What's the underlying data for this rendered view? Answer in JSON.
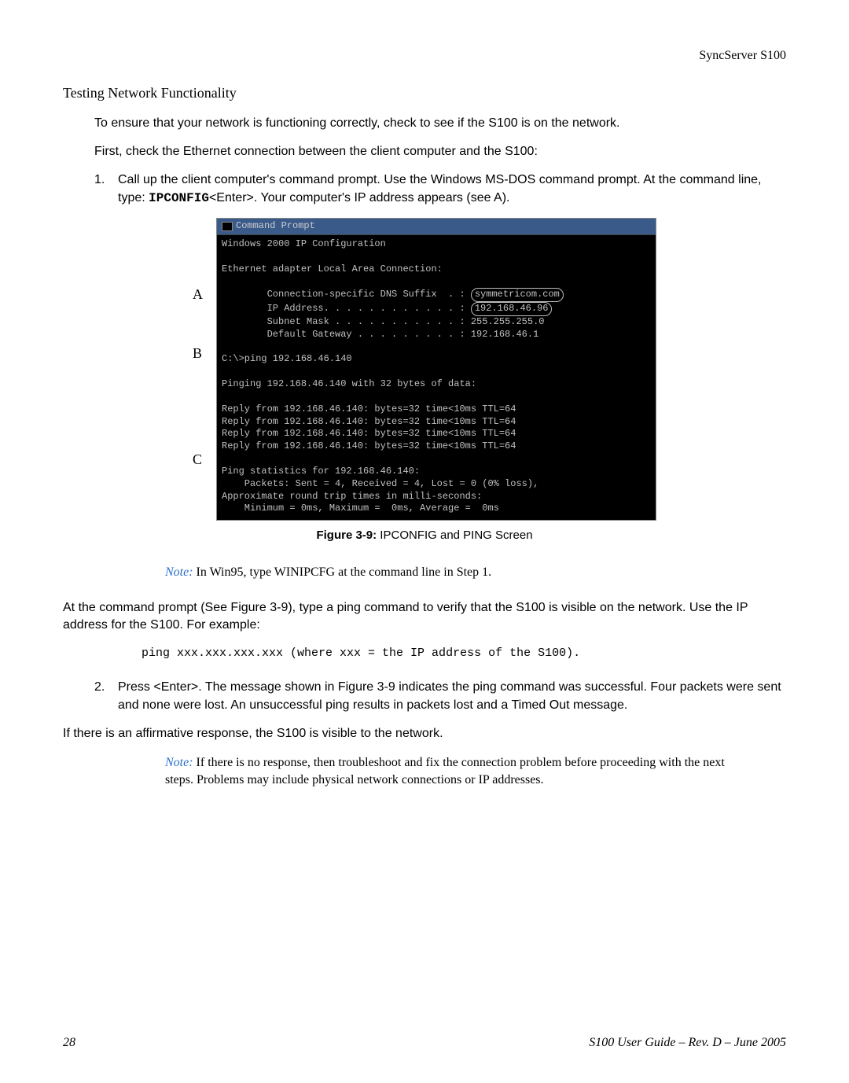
{
  "header": {
    "product": "SyncServer S100"
  },
  "title": "Testing Network Functionality",
  "para1": "To ensure that your network is functioning correctly, check to see if the S100 is on the network.",
  "para2": "First, check the Ethernet connection between the client computer and the S100:",
  "step1_num": "1.",
  "step1_a": "Call up the client computer's command prompt. Use the Windows MS-DOS command prompt. At the command line, type: ",
  "step1_cmd": "IPCONFIG",
  "step1_b": "<Enter>. Your computer's IP address appears (see A).",
  "markers": {
    "a": "A",
    "b": "B",
    "c": "C"
  },
  "terminal": {
    "title": "Command Prompt",
    "line1": "Windows 2000 IP Configuration",
    "line2": "Ethernet adapter Local Area Connection:",
    "cfg1a": "        Connection-specific DNS Suffix  . : ",
    "cfg1b": "symmetricom.com",
    "cfg2a": "        IP Address. . . . . . . . . . . . : ",
    "cfg2b": "192.168.46.96",
    "cfg3": "        Subnet Mask . . . . . . . . . . . : 255.255.255.0",
    "cfg4": "        Default Gateway . . . . . . . . . : 192.168.46.1",
    "pingcmd": "C:\\>ping 192.168.46.140",
    "pinghdr": "Pinging 192.168.46.140 with 32 bytes of data:",
    "r1": "Reply from 192.168.46.140: bytes=32 time<10ms TTL=64",
    "r2": "Reply from 192.168.46.140: bytes=32 time<10ms TTL=64",
    "r3": "Reply from 192.168.46.140: bytes=32 time<10ms TTL=64",
    "r4": "Reply from 192.168.46.140: bytes=32 time<10ms TTL=64",
    "s1": "Ping statistics for 192.168.46.140:",
    "s2": "    Packets: Sent = 4, Received = 4, Lost = 0 (0% loss),",
    "s3": "Approximate round trip times in milli-seconds:",
    "s4": "    Minimum = 0ms, Maximum =  0ms, Average =  0ms"
  },
  "fig_caption_bold": "Figure 3-9:",
  "fig_caption_rest": "  IPCONFIG and PING Screen",
  "note1_label": "Note:",
  "note1_text": "  In Win95, type WINIPCFG at the command line in Step 1.",
  "para3": "At the command prompt (See Figure 3-9), type a ping command to verify that the S100 is visible on the network. Use the IP address for the S100. For example:",
  "code1": "ping xxx.xxx.xxx.xxx (where xxx = the IP address of the S100).",
  "step2_num": "2.",
  "step2": "Press <Enter>. The message shown in Figure 3-9 indicates the ping command was successful. Four packets were sent and none were lost. An unsuccessful ping results in packets lost and a Timed Out message.",
  "para4": "If there is an affirmative response, the S100 is visible to the network.",
  "note2_label": "Note:",
  "note2_text": "  If there is no response, then troubleshoot and fix the connection problem before proceeding with the next steps. Problems may include physical network connections or IP addresses.",
  "footer": {
    "page": "28",
    "doc": "S100 User Guide – Rev. D – June 2005"
  }
}
